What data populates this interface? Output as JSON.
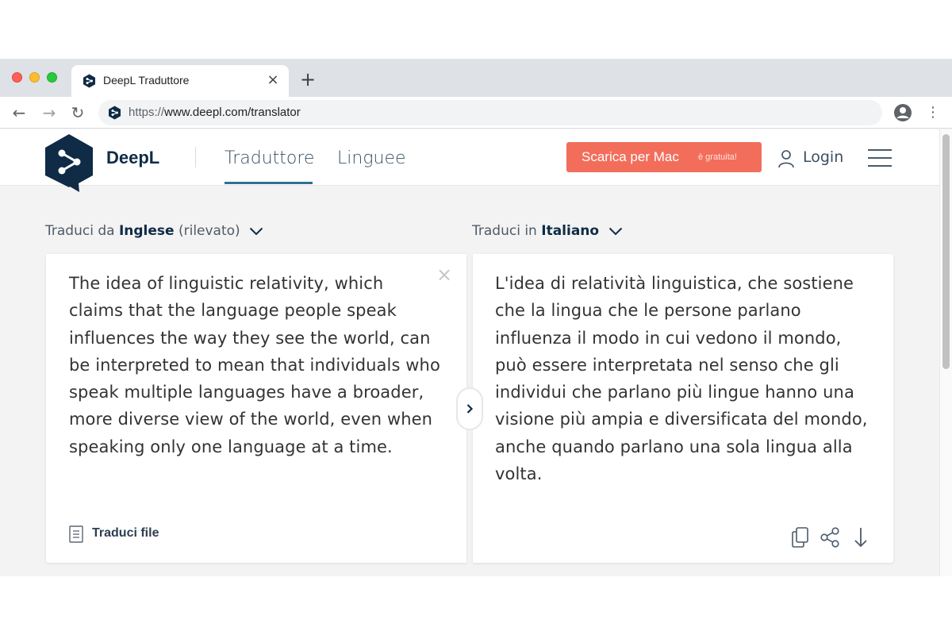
{
  "browser": {
    "tab": {
      "title": "DeepL Traduttore",
      "close": "×"
    },
    "new_tab": "+",
    "url_scheme": "https://",
    "url_rest": "www.deepl.com/translator",
    "nav": {
      "back": "←",
      "forward": "→",
      "reload": "↻",
      "menu": "⋮"
    }
  },
  "header": {
    "brand": "DeepL",
    "nav": [
      {
        "label": "Traduttore",
        "active": true
      },
      {
        "label": "Linguee",
        "active": false
      }
    ],
    "download": {
      "label": "Scarica per Mac",
      "note": "è gratuita!"
    },
    "login": "Login"
  },
  "colors": {
    "brand_navy": "#0f2b46",
    "download_button": "#f26e5b",
    "active_tab_underline": "#2d7192"
  },
  "source": {
    "prefix": "Traduci da",
    "language": "Inglese",
    "suffix": "(rilevato)",
    "text": "The idea of linguistic relativity, which claims that the language people speak influences the way they see the world, can be interpreted to mean that individuals who speak multiple languages have a broader, more diverse view of the world, even when speaking only one language at a time.",
    "clear": "×",
    "translate_file": "Traduci file"
  },
  "target": {
    "prefix": "Traduci in",
    "language": "Italiano",
    "text": "L'idea di relatività linguistica, che sostiene che la lingua che le persone parlano influenza il modo in cui vedono il mondo, può essere interpretata nel senso che gli individui che parlano più lingue hanno una visione più ampia e diversificata del mondo, anche quando parlano una sola lingua alla volta."
  },
  "icons": [
    "deepl-logo-icon",
    "chevron-down-icon",
    "close-icon",
    "document-icon",
    "chevron-right-icon",
    "copy-icon",
    "share-icon",
    "download-arrow-icon",
    "user-icon",
    "hamburger-icon",
    "profile-icon"
  ]
}
